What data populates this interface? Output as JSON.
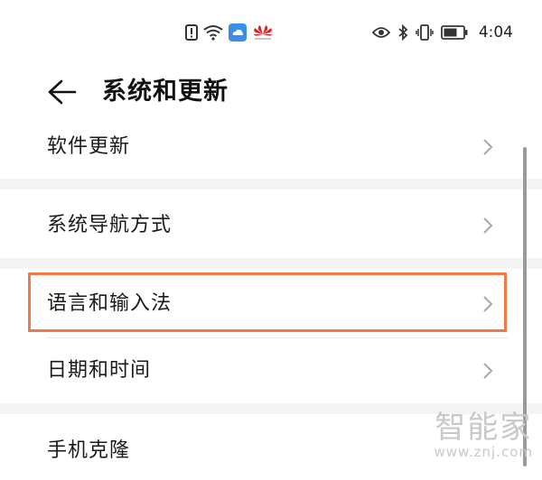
{
  "status_bar": {
    "time": "4:04",
    "left_icons": [
      "alert-icon",
      "wifi-icon",
      "cloud-app-icon",
      "huawei-logo-icon"
    ],
    "right_icons": [
      "eye-icon",
      "bluetooth-icon",
      "vibrate-icon",
      "battery-icon"
    ]
  },
  "header": {
    "title": "系统和更新"
  },
  "settings_items": [
    {
      "label": "软件更新"
    },
    {
      "label": "系统导航方式"
    },
    {
      "label": "语言和输入法"
    },
    {
      "label": "日期和时间"
    },
    {
      "label": "手机克隆"
    }
  ],
  "highlight_color": "#ee7a45",
  "watermark": {
    "text": "智能家",
    "url": "www.znj.com"
  }
}
